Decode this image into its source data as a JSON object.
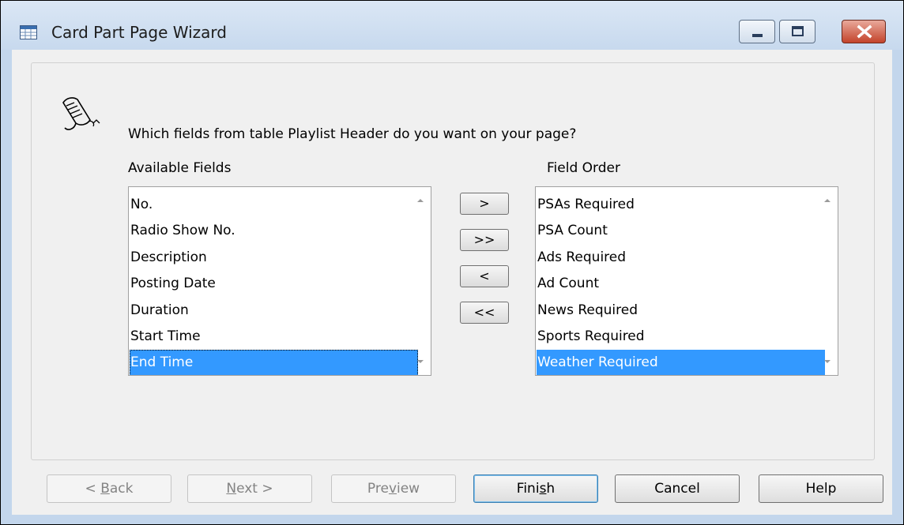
{
  "window": {
    "title": "Card Part Page Wizard"
  },
  "prompt": "Which fields from table Playlist Header do you want on your page?",
  "available": {
    "label": "Available Fields",
    "items": [
      "No.",
      "Radio Show No.",
      "Description",
      "Posting Date",
      "Duration",
      "Start Time",
      "End Time"
    ],
    "selected": "End Time"
  },
  "order": {
    "label": "Field Order",
    "items": [
      "PSAs Required",
      "PSA Count",
      "Ads Required",
      "Ad Count",
      "News Required",
      "Sports Required",
      "Weather Required"
    ],
    "selected": "Weather Required"
  },
  "movers": {
    "add": ">",
    "add_all": ">>",
    "remove": "<",
    "remove_all": "<<"
  },
  "buttons": {
    "back": {
      "pre": "< ",
      "key": "B",
      "post": "ack"
    },
    "next": {
      "pre": "",
      "key": "N",
      "post": "ext >"
    },
    "preview": {
      "pre": "Pre",
      "key": "v",
      "post": "iew"
    },
    "finish": {
      "pre": "Fini",
      "key": "s",
      "post": "h"
    },
    "cancel": {
      "pre": "Cancel",
      "key": "",
      "post": ""
    },
    "help": {
      "pre": "Help",
      "key": "",
      "post": ""
    }
  },
  "colors": {
    "selection": "#3399ff",
    "titlebar": "#c7d9ee",
    "close_button": "#c3432b"
  },
  "icons": {
    "title": "table-icon",
    "wizard": "wizard-scroll-icon"
  }
}
